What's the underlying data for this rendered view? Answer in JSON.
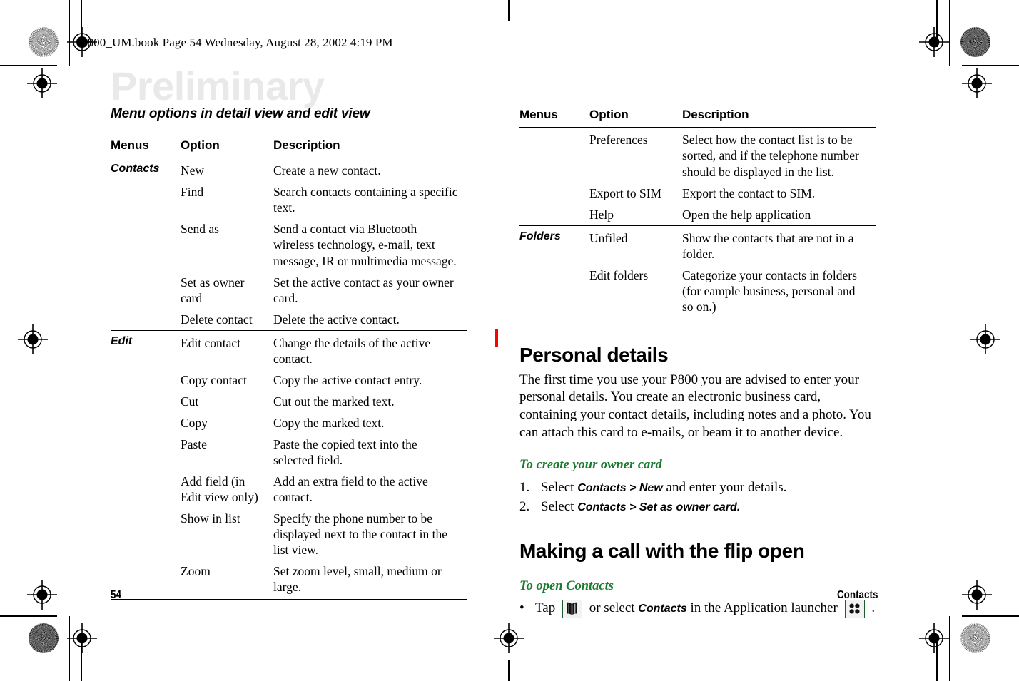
{
  "header": {
    "book_line": "P800_UM.book  Page 54  Wednesday, August 28, 2002  4:19 PM",
    "watermark": "Preliminary"
  },
  "left_column": {
    "section_heading": "Menu options in detail view and edit view",
    "table": {
      "columns": [
        "Menus",
        "Option",
        "Description"
      ],
      "rows": [
        {
          "menu": "Contacts",
          "option": "New",
          "description": "Create a new contact.",
          "group_start": true
        },
        {
          "menu": "",
          "option": "Find",
          "description": "Search contacts containing a specific text."
        },
        {
          "menu": "",
          "option": "Send as",
          "description": "Send a contact via Bluetooth wireless technology, e-mail, text message, IR or multimedia message."
        },
        {
          "menu": "",
          "option": "Set as owner card",
          "description": "Set the active contact as your owner card."
        },
        {
          "menu": "",
          "option": "Delete contact",
          "description": "Delete the active contact."
        },
        {
          "menu": "Edit",
          "option": "Edit contact",
          "description": "Change the details of the active contact.",
          "group_start": true
        },
        {
          "menu": "",
          "option": "Copy contact",
          "description": "Copy the active contact entry."
        },
        {
          "menu": "",
          "option": "Cut",
          "description": "Cut out the marked text."
        },
        {
          "menu": "",
          "option": "Copy",
          "description": "Copy the marked text."
        },
        {
          "menu": "",
          "option": "Paste",
          "description": "Paste the copied text into the selected field."
        },
        {
          "menu": "",
          "option": "Add field (in Edit view only)",
          "description": "Add an extra field to the active contact."
        },
        {
          "menu": "",
          "option": "Show in list",
          "description": "Specify the phone number to be displayed next to the contact in the list view."
        },
        {
          "menu": "",
          "option": "Zoom",
          "description": "Set zoom level, small, medium or large."
        }
      ]
    }
  },
  "right_column": {
    "table": {
      "columns": [
        "Menus",
        "Option",
        "Description"
      ],
      "rows": [
        {
          "menu": "",
          "option": "Preferences",
          "description": "Select how the contact list is to be sorted, and if the telephone number should be displayed in the list."
        },
        {
          "menu": "",
          "option": "Export to SIM",
          "description": "Export the contact to SIM."
        },
        {
          "menu": "",
          "option": "Help",
          "description": "Open the help application"
        },
        {
          "menu": "Folders",
          "option": "Unfiled",
          "description": "Show the contacts that are not in a folder.",
          "group_start": true
        },
        {
          "menu": "",
          "option": "Edit folders",
          "description": "Categorize your contacts in folders (for eample business, personal and so on.)"
        }
      ]
    },
    "personal_details": {
      "title": "Personal details",
      "paragraph": "The first time you use your P800 you are advised to enter your personal details. You create an electronic business card, containing your contact details, including notes and a photo. You can attach this card to e-mails, or beam it to another device.",
      "procedure_title": "To create your owner card",
      "steps": [
        {
          "num": "1.",
          "pre": "Select ",
          "ui": "Contacts > New",
          "post": " and enter your details."
        },
        {
          "num": "2.",
          "pre": "Select ",
          "ui": "Contacts > Set as owner card.",
          "post": ""
        }
      ]
    },
    "making_call": {
      "title": "Making a call with the flip open",
      "procedure_title": "To open Contacts",
      "bullet": {
        "dot": "•",
        "part1": "Tap",
        "contacts_icon_name": "contacts-book-icon",
        "part2": "or select",
        "ui": "Contacts",
        "part3": "in the Application launcher",
        "launcher_icon_name": "application-launcher-icon",
        "part4": "."
      }
    }
  },
  "footer": {
    "page_number": "54",
    "chapter": "Contacts"
  },
  "colors": {
    "green_heading": "#1a7a2e",
    "change_bar": "#ff0000",
    "watermark": "#e9e9e9",
    "icon_border": "#1d5c33"
  }
}
